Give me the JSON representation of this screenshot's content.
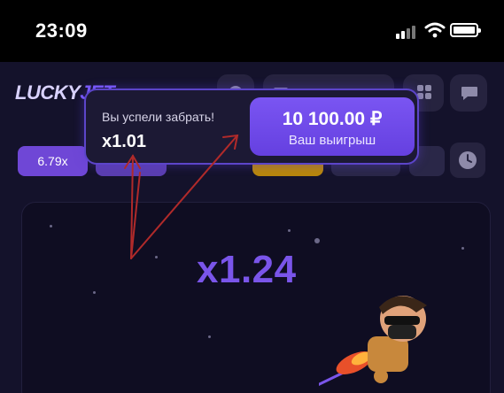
{
  "status_bar": {
    "time": "23:09"
  },
  "header": {
    "logo_main": "LUCKY",
    "logo_tail": "JET"
  },
  "history": {
    "first": "6.79x"
  },
  "popup": {
    "title": "Вы успели забрать!",
    "multiplier": "x1.01",
    "win_amount": "10 100.00 ₽",
    "win_label": "Ваш выигрыш"
  },
  "game": {
    "current_multiplier": "x1.24"
  },
  "colors": {
    "accent": "#7a55ea",
    "popup_border": "#5c45c9",
    "annotation": "#b02a2a"
  },
  "icons": [
    "wifi-icon",
    "battery-icon",
    "help-icon",
    "wallet-icon",
    "grid-icon",
    "chat-icon",
    "clock-icon"
  ]
}
